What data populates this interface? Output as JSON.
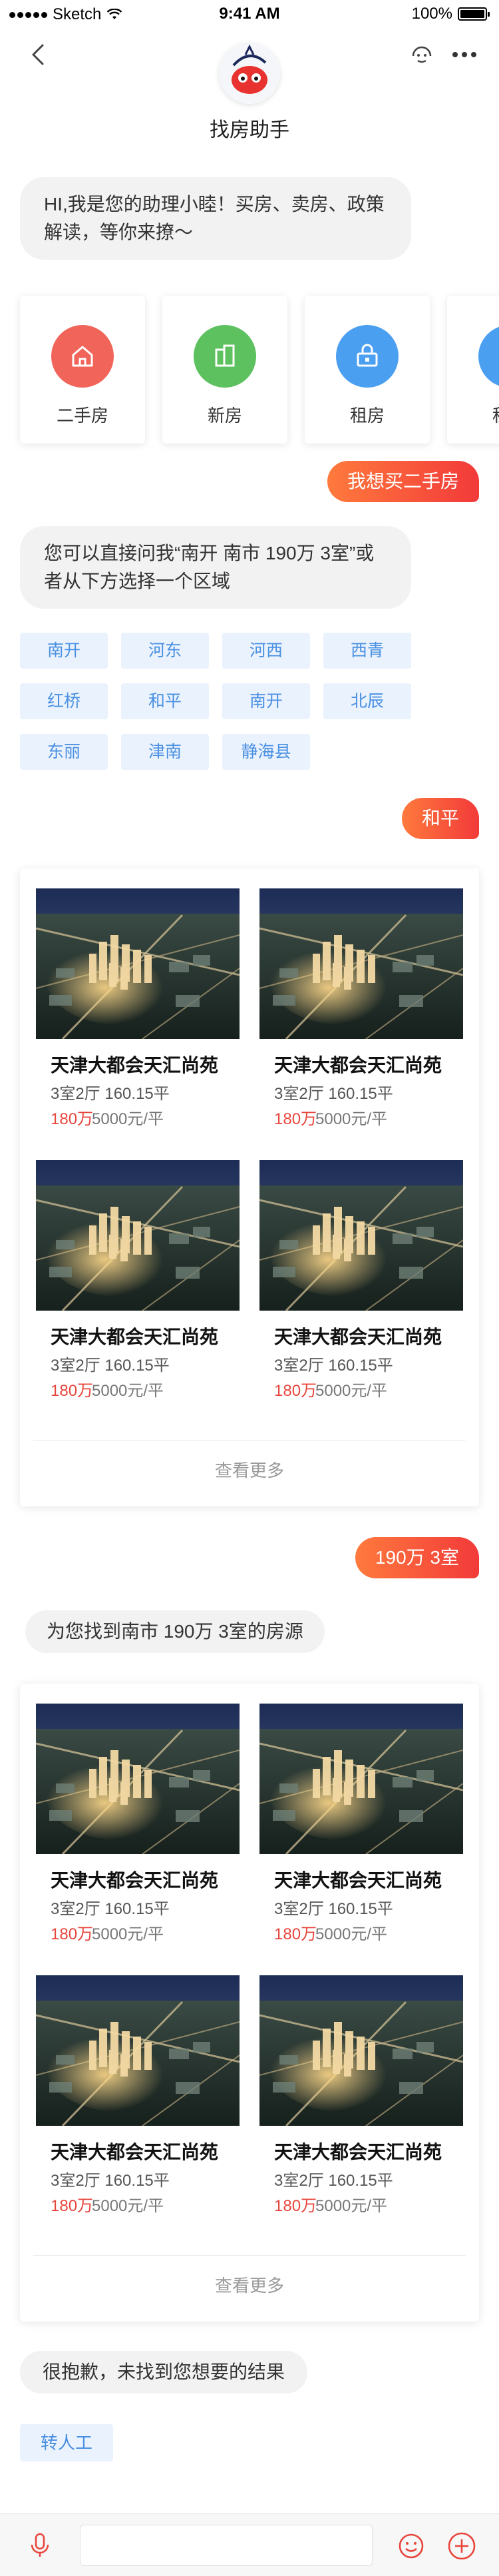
{
  "status_bar": {
    "carrier": "Sketch",
    "time": "9:41 AM",
    "battery": "100%"
  },
  "header": {
    "title": "找房助手"
  },
  "messages": {
    "greeting": "HI,我是您的助理小睦！买房、卖房、政策解读，等你来撩～",
    "user_buy": "我想买二手房",
    "prompt_area": "您可以直接问我“南开 南市 190万 3室”或者从下方选择一个区域",
    "user_district": "和平",
    "user_query": "190万 3室",
    "found_text": "为您找到南市 190万 3室的房源",
    "sorry_text": "很抱歉，未找到您想要的结果"
  },
  "categories": [
    {
      "label": "二手房",
      "color": "#f0645a",
      "icon": "home-icon"
    },
    {
      "label": "新房",
      "color": "#5cc15e",
      "icon": "building-icon"
    },
    {
      "label": "租房",
      "color": "#4a9ff0",
      "icon": "key-icon"
    },
    {
      "label": "租房",
      "color": "#4a9ff0",
      "icon": "key-icon"
    }
  ],
  "districts": [
    "南开",
    "河东",
    "河西",
    "西青",
    "红桥",
    "和平",
    "南开",
    "北辰",
    "东丽",
    "津南",
    "静海县"
  ],
  "listing_groups": [
    {
      "listings": [
        {
          "name": "天津大都会天汇尚苑",
          "spec": "3室2厅 160.15平",
          "price": "180万",
          "unit_price": "5000元/平"
        },
        {
          "name": "天津大都会天汇尚苑",
          "spec": "3室2厅 160.15平",
          "price": "180万",
          "unit_price": "5000元/平"
        },
        {
          "name": "天津大都会天汇尚苑",
          "spec": "3室2厅 160.15平",
          "price": "180万",
          "unit_price": "5000元/平"
        },
        {
          "name": "天津大都会天汇尚苑",
          "spec": "3室2厅 160.15平",
          "price": "180万",
          "unit_price": "5000元/平"
        }
      ],
      "more": "查看更多"
    },
    {
      "listings": [
        {
          "name": "天津大都会天汇尚苑",
          "spec": "3室2厅 160.15平",
          "price": "180万",
          "unit_price": "5000元/平"
        },
        {
          "name": "天津大都会天汇尚苑",
          "spec": "3室2厅 160.15平",
          "price": "180万",
          "unit_price": "5000元/平"
        },
        {
          "name": "天津大都会天汇尚苑",
          "spec": "3室2厅 160.15平",
          "price": "180万",
          "unit_price": "5000元/平"
        },
        {
          "name": "天津大都会天汇尚苑",
          "spec": "3室2厅 160.15平",
          "price": "180万",
          "unit_price": "5000元/平"
        }
      ],
      "more": "查看更多"
    }
  ],
  "transfer_button": "转人工",
  "colors": {
    "accent_orange": "#ff7a3d",
    "accent_red": "#f23a3a",
    "chip_blue": "#4a90e2",
    "price_red": "#e8453c"
  }
}
